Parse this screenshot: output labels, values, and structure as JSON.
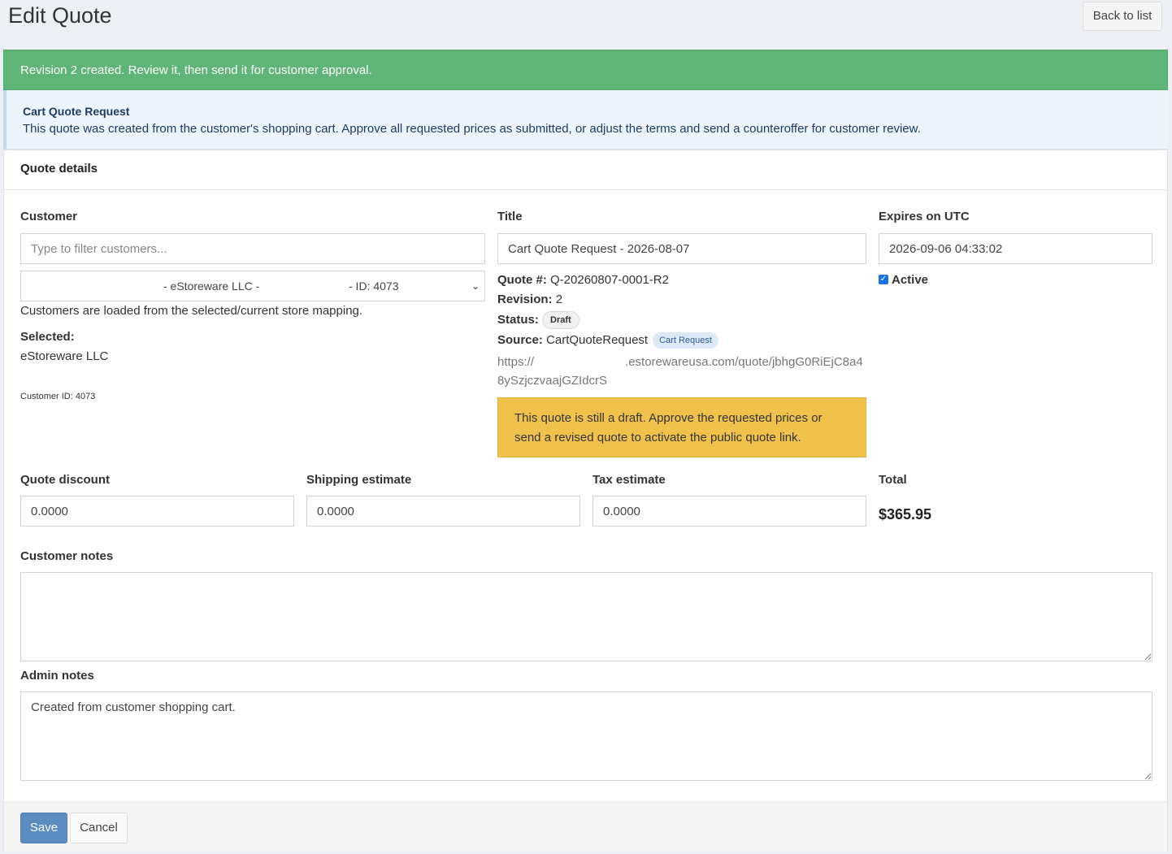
{
  "header": {
    "title": "Edit Quote",
    "back_label": "Back to list"
  },
  "alert": {
    "text": "Revision 2 created. Review it, then send it for customer approval."
  },
  "callout": {
    "title": "Cart Quote Request",
    "text": "This quote was created from the customer's shopping cart. Approve all requested prices as submitted, or adjust the terms and send a counteroffer for customer review."
  },
  "box": {
    "title": "Quote details"
  },
  "customer": {
    "label": "Customer",
    "filter_placeholder": "Type to filter customers...",
    "select_name": "- eStoreware LLC -",
    "select_id": "- ID: 4073",
    "help_text": "Customers are loaded from the selected/current store mapping.",
    "selected_label": "Selected:",
    "selected_name": "eStoreware LLC",
    "customer_id_text": "Customer ID: 4073"
  },
  "title_field": {
    "label": "Title",
    "value": "Cart Quote Request - 2026-08-07"
  },
  "quote_info": {
    "number_label": "Quote #:",
    "number_value": "Q-20260807-0001-R2",
    "revision_label": "Revision:",
    "revision_value": "2",
    "status_label": "Status:",
    "status_badge": "Draft",
    "source_label": "Source:",
    "source_value": "CartQuoteRequest",
    "source_badge": "Cart Request",
    "url_line1_a": "https://",
    "url_line1_b": ".estorewareusa.com/quote/jbhgG0RiEjC8a4",
    "url_line2": "8ySzjczvaajGZIdcrS",
    "draft_warning": "This quote is still a draft. Approve the requested prices or send a revised quote to activate the public quote link."
  },
  "expires": {
    "label": "Expires on UTC",
    "value": "2026-09-06 04:33:02",
    "active_label": "Active",
    "active_checked": true
  },
  "amounts": {
    "discount_label": "Quote discount",
    "discount_value": "0.0000",
    "shipping_label": "Shipping estimate",
    "shipping_value": "0.0000",
    "tax_label": "Tax estimate",
    "tax_value": "0.0000",
    "total_label": "Total",
    "total_value": "$365.95"
  },
  "notes": {
    "customer_label": "Customer notes",
    "customer_value": "",
    "admin_label": "Admin notes",
    "admin_value": "Created from customer shopping cart."
  },
  "footer": {
    "save_label": "Save",
    "cancel_label": "Cancel"
  },
  "colors": {
    "success": "#5fb478",
    "info_bg": "#eef4fb",
    "warning": "#f0c24c",
    "primary": "#5b8dc2"
  }
}
